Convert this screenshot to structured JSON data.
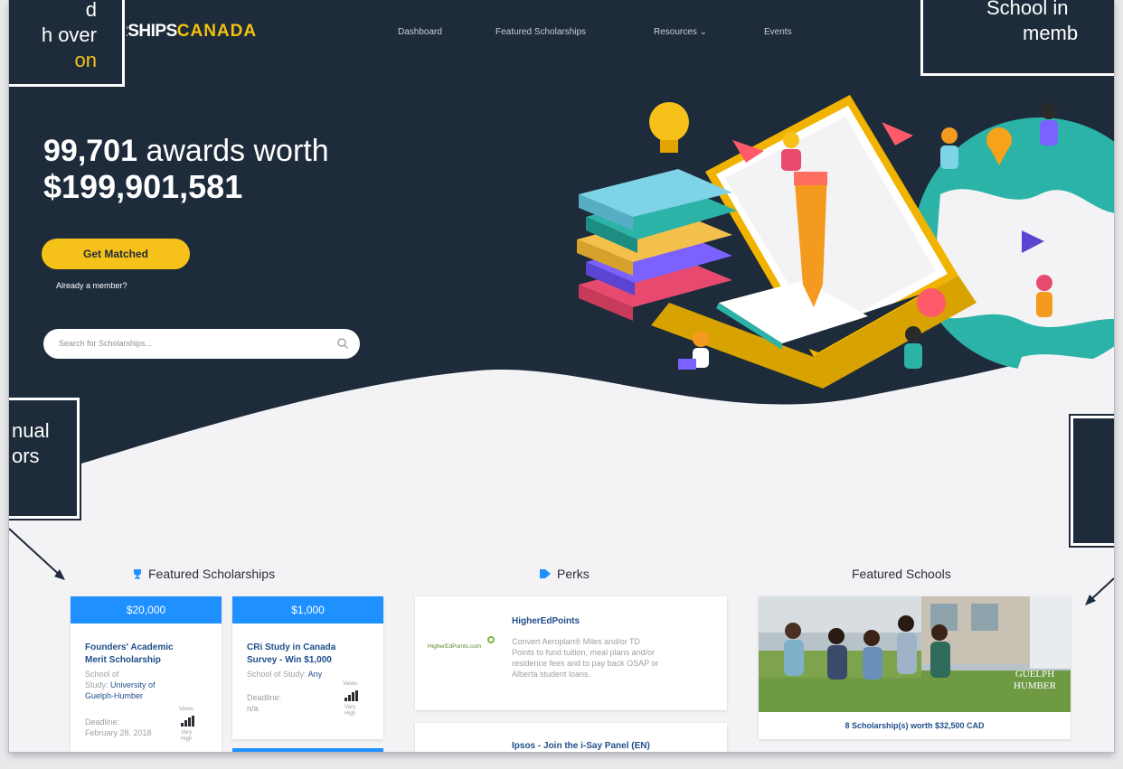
{
  "brand": {
    "name_plain": "RSHIPS",
    "name_accent": "CANADA"
  },
  "nav": {
    "items": [
      {
        "label": "Dashboard"
      },
      {
        "label": "Featured Scholarships"
      },
      {
        "label": "Resources ⌄"
      },
      {
        "label": "Events"
      }
    ]
  },
  "hero": {
    "award_count": "99,701",
    "award_text": "awards worth",
    "total_amount": "$199,901,581",
    "cta_label": "Get Matched",
    "member_link": "Already a member?",
    "search_placeholder": "Search for Scholarships..."
  },
  "featured_scholarships": {
    "title": "Featured Scholarships",
    "cards": [
      {
        "amount": "$20,000",
        "title_line1": "Founders' Academic",
        "title_line2": "Merit Scholarship",
        "school_label1": "School of",
        "school_label2": "Study:",
        "school_name1": "University of",
        "school_name2": "Guelph-Humber",
        "deadline_label": "Deadline:",
        "deadline_value": "February 28, 2018",
        "views_label": "Views",
        "views_level1": "Very",
        "views_level2": "High"
      },
      {
        "amount": "$1,000",
        "title_line1": "CRi Study in Canada",
        "title_line2": "Survey - Win $1,000",
        "school_label1": "School of Study:",
        "school_name1": "Any",
        "deadline_label": "Deadline:",
        "deadline_value": "n/a",
        "views_label": "Views",
        "views_level1": "Very",
        "views_level2": "High"
      }
    ]
  },
  "perks": {
    "title": "Perks",
    "items": [
      {
        "title": "HigherEdPoints",
        "logo_text": "HigherEdPoints.com",
        "desc1": "Convert Aeroplan® Miles and/or TD",
        "desc2": "Points to fund tuition, meal plans and/or",
        "desc3": "residence fees and to pay back OSAP or",
        "desc4": "Alberta student loans."
      },
      {
        "title": "Ipsos - Join the i-Say Panel (EN)"
      }
    ]
  },
  "featured_schools": {
    "title": "Featured Schools",
    "school_logo_line1": "GUELPH",
    "school_logo_line2": "HUMBER",
    "summary": "8 Scholarship(s) worth $32,500 CAD"
  },
  "callouts": {
    "top_left_line1": "d",
    "top_left_line2": "h over",
    "top_left_line3": "on",
    "top_right_line1": "School in",
    "top_right_line2": "memb",
    "mid_left_line1": "nual",
    "mid_left_line2": "ors"
  },
  "colors": {
    "hero_bg": "#1d2b3b",
    "accent_yellow": "#f6c21a",
    "accent_blue": "#1e90ff"
  }
}
